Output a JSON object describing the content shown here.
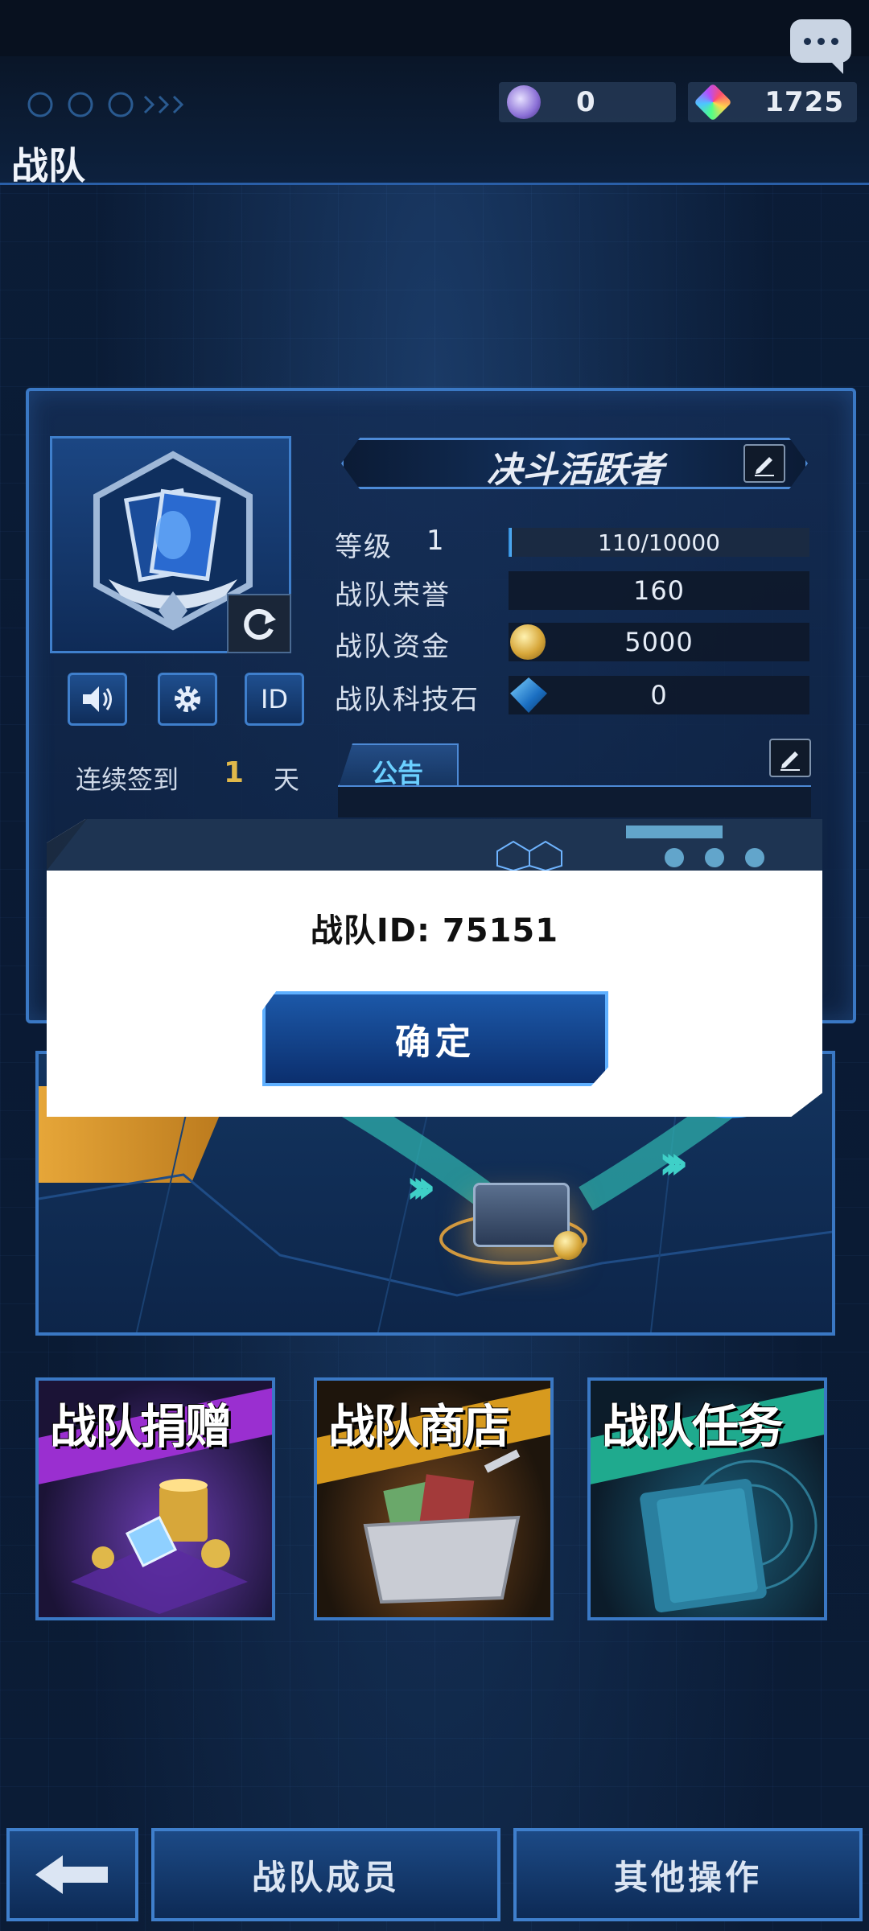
{
  "header": {
    "title": "战队",
    "currencies": [
      {
        "icon": "orb-currency-icon",
        "value": "0"
      },
      {
        "icon": "rainbow-gem-icon",
        "value": "1725"
      }
    ]
  },
  "team": {
    "name": "决斗活跃者",
    "level_label": "等级",
    "level_value": "1",
    "exp_text": "110/10000",
    "exp_fraction": 0.011,
    "honor_label": "战队荣誉",
    "honor_value": "160",
    "funds_label": "战队资金",
    "funds_value": "5000",
    "techstone_label": "战队科技石",
    "techstone_value": "0",
    "id_button_label": "ID"
  },
  "checkin": {
    "label": "连续签到",
    "value": "1",
    "unit": "天"
  },
  "notice": {
    "tab_label": "公告"
  },
  "tiles": [
    {
      "label": "战队捐赠"
    },
    {
      "label": "战队商店"
    },
    {
      "label": "战队任务"
    }
  ],
  "bottom": {
    "members_label": "战队成员",
    "other_label": "其他操作"
  },
  "dialog": {
    "message": "战队ID: 75151",
    "confirm_label": "确定"
  },
  "colors": {
    "accent_blue": "#3a78c4",
    "gold": "#e0b84a"
  }
}
